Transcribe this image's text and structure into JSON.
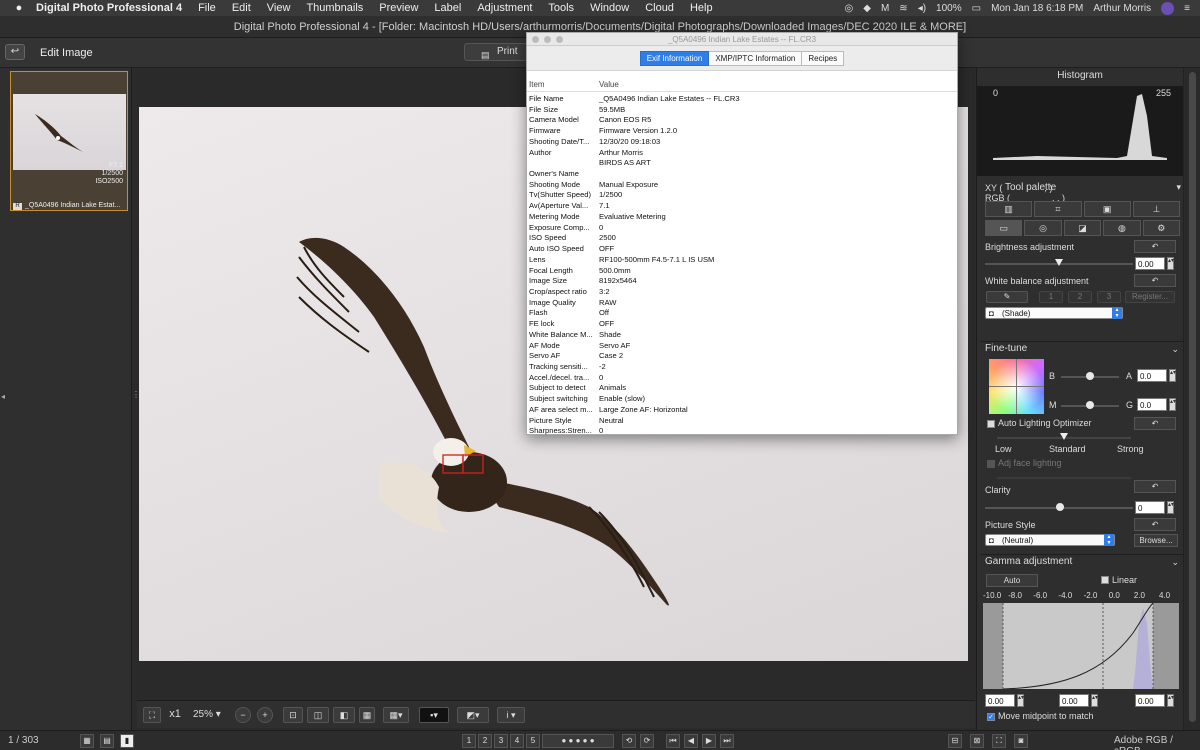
{
  "menubar": {
    "app": "Digital Photo Professional 4",
    "items": [
      "File",
      "Edit",
      "View",
      "Thumbnails",
      "Preview",
      "Label",
      "Adjustment",
      "Tools",
      "Window",
      "Cloud",
      "Help"
    ],
    "battery": "100%",
    "clock": "Mon Jan 18  6:18 PM",
    "user": "Arthur Morris"
  },
  "window": {
    "title": "Digital Photo Professional 4 - [Folder: Macintosh HD/Users/arthurmorris/Documents/Digital Photographs/Downloaded Images/DEC 2020 ILE & MORE]"
  },
  "toolbar": {
    "mode_label": "Edit Image",
    "print_label": "Print"
  },
  "thumbnail": {
    "label": "_Q5A0496  Indian Lake Estat...",
    "badge": "R",
    "meta": [
      "F7.1",
      "1/2500",
      "ISO2500"
    ]
  },
  "exif_window": {
    "title": "_Q5A0496  Indian Lake Estates -- FL.CR3",
    "tabs": [
      {
        "label": "Exif Information",
        "active": true
      },
      {
        "label": "XMP/IPTC Information",
        "active": false
      },
      {
        "label": "Recipes",
        "active": false
      }
    ],
    "col_item": "Item",
    "col_value": "Value",
    "rows": [
      [
        "File Name",
        "_Q5A0496  Indian Lake Estates -- FL.CR3"
      ],
      [
        "File Size",
        "59.5MB"
      ],
      [
        "Camera Model",
        "Canon EOS R5"
      ],
      [
        "Firmware",
        "Firmware Version 1.2.0"
      ],
      [
        "Shooting Date/T...",
        "12/30/20 09:18:03"
      ],
      [
        "Author",
        "Arthur Morris"
      ],
      [
        "",
        "BIRDS AS ART"
      ],
      [
        "Owner's Name",
        ""
      ],
      [
        "Shooting Mode",
        "Manual Exposure"
      ],
      [
        "Tv(Shutter Speed)",
        "1/2500"
      ],
      [
        "Av(Aperture Val...",
        "7.1"
      ],
      [
        "Metering Mode",
        "Evaluative Metering"
      ],
      [
        "Exposure Comp...",
        "0"
      ],
      [
        "ISO Speed",
        "2500"
      ],
      [
        "Auto ISO Speed",
        "OFF"
      ],
      [
        "Lens",
        "RF100-500mm F4.5-7.1 L IS USM"
      ],
      [
        "Focal Length",
        "500.0mm"
      ],
      [
        "Image Size",
        "8192x5464"
      ],
      [
        "Crop/aspect ratio",
        "3:2"
      ],
      [
        "Image Quality",
        "RAW"
      ],
      [
        "Flash",
        "Off"
      ],
      [
        "FE lock",
        "OFF"
      ],
      [
        "White Balance M...",
        "Shade"
      ],
      [
        "AF Mode",
        "Servo AF"
      ],
      [
        "Servo AF",
        "Case 2"
      ],
      [
        "Tracking sensiti...",
        "-2"
      ],
      [
        "Accel./decel. tra...",
        "0"
      ],
      [
        "Subject to detect",
        "Animals"
      ],
      [
        "Subject switching",
        "Enable (slow)"
      ],
      [
        "AF area select m...",
        "Large Zone AF: Horizontal"
      ],
      [
        "Picture Style",
        "Neutral"
      ],
      [
        "Sharpness:Stren...",
        "0"
      ]
    ]
  },
  "bottombar": {
    "zoom_x1": "x1",
    "zoom_pct": "25%"
  },
  "statusbar": {
    "count": "1 / 303",
    "ratings": [
      "1",
      "2",
      "3",
      "4",
      "5"
    ],
    "colorspace": "Adobe RGB / sRGB"
  },
  "right": {
    "histogram_title": "Histogram",
    "hist_min": "0",
    "hist_max": "255",
    "xy_label": "XY (",
    "xy_close": ", )",
    "rgb_label": "RGB (",
    "rgb_close": ", , )",
    "tool_palette_title": "Tool palette",
    "brightness_label": "Brightness adjustment",
    "brightness_value": "0.00",
    "brightness_level": 0.5,
    "wb_label": "White balance adjustment",
    "wb_buttons": [
      "1",
      "2",
      "3",
      "Register..."
    ],
    "wb_select": "(Shade)",
    "finetune_title": "Fine-tune",
    "ft_b": "B",
    "ft_a": "A",
    "ft_m": "M",
    "ft_g": "G",
    "ft_a_value": "0.0",
    "ft_g_value": "0.0",
    "alo_label": "Auto Lighting Optimizer",
    "alo_levels": [
      "Low",
      "Standard",
      "Strong"
    ],
    "adj_face": "Adj face lighting",
    "clarity_label": "Clarity",
    "clarity_value": "0",
    "picture_style_label": "Picture Style",
    "picture_style_select": "(Neutral)",
    "browse_label": "Browse...",
    "gamma_title": "Gamma adjustment",
    "auto_label": "Auto",
    "linear_label": "Linear",
    "gamma_ticks": [
      "-10.0",
      "-8.0",
      "-6.0",
      "-4.0",
      "-2.0",
      "0.0",
      "2.0",
      "4.0"
    ],
    "gamma_values": [
      "0.00",
      "0.00",
      "0.00"
    ],
    "midpoint_label": "Move midpoint to match"
  },
  "colors": {
    "accent": "#2f7de6",
    "thumb_border": "#c88d2e",
    "af_box": "#d0201a"
  }
}
